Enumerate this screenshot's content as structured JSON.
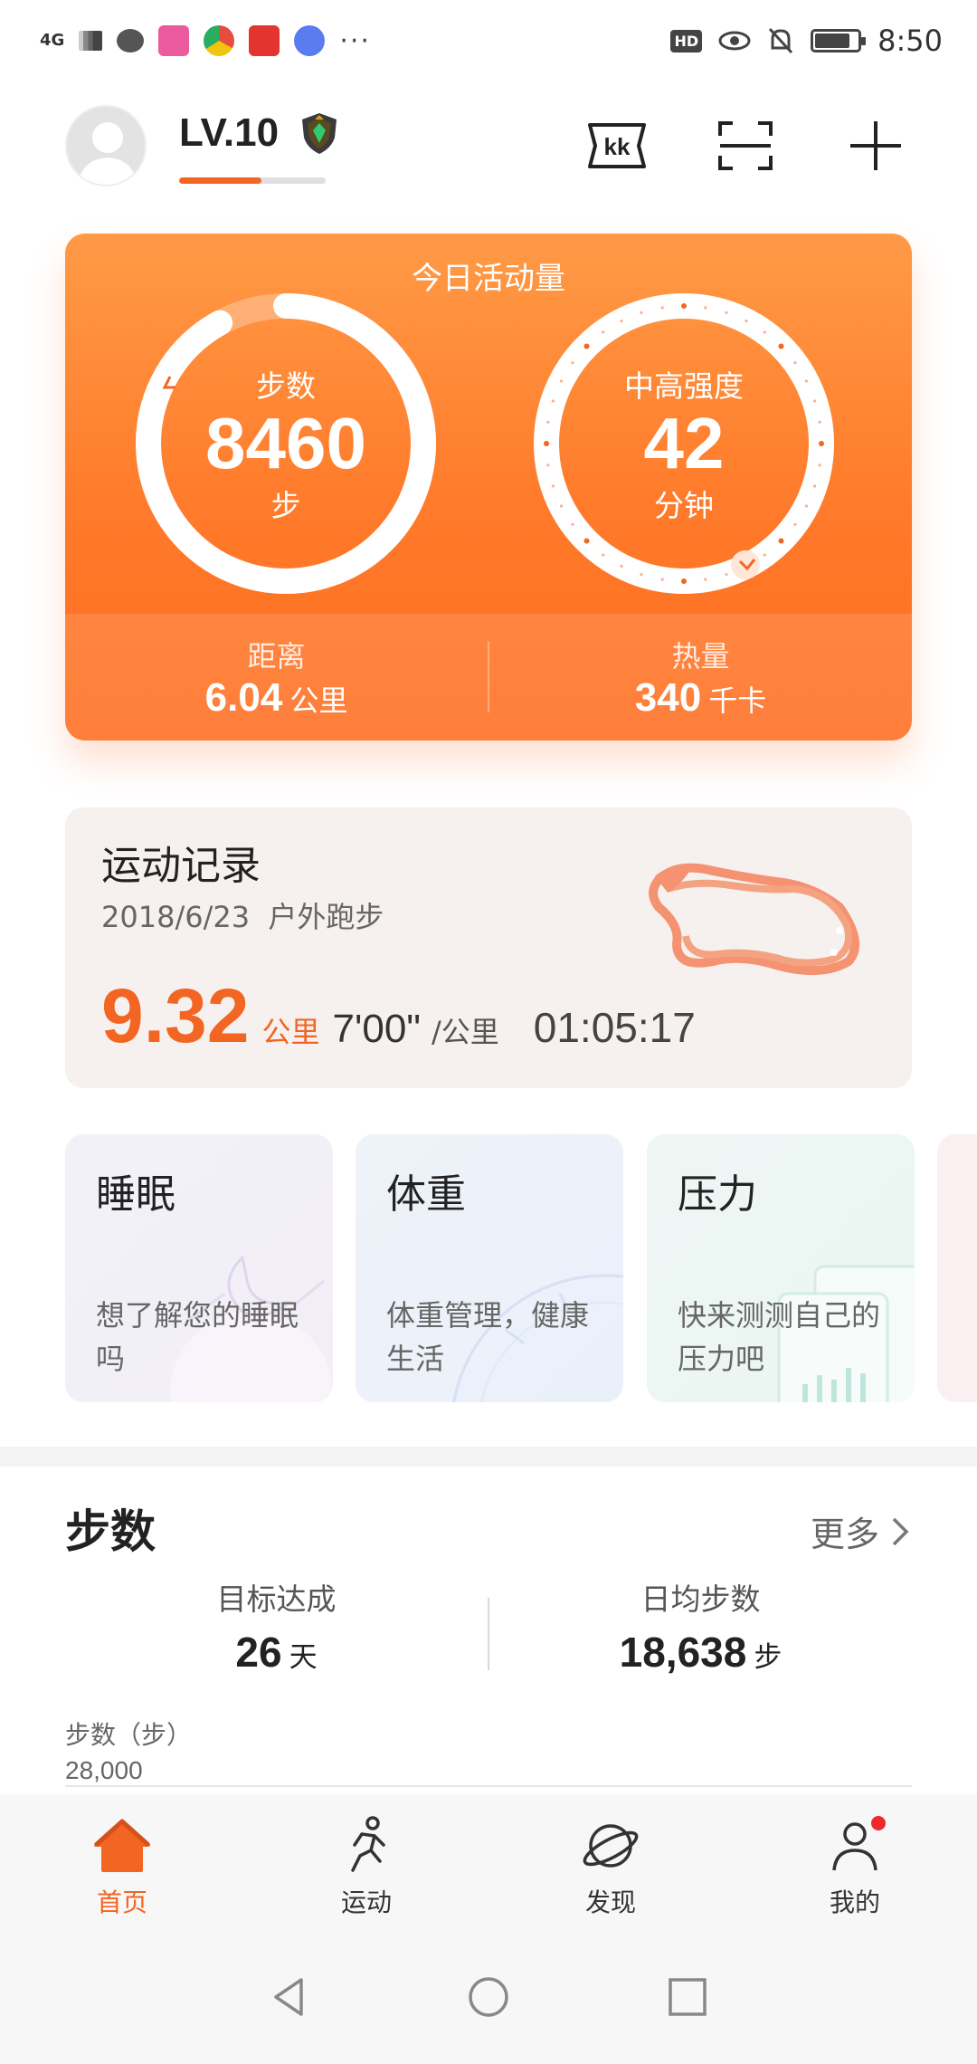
{
  "status_bar": {
    "network": "4G",
    "time": "8:50",
    "hd_label": "HD",
    "battery_level": 0.85
  },
  "header": {
    "level": "LV.10",
    "level_progress": 0.56
  },
  "activity": {
    "title": "今日活动量",
    "steps": {
      "label": "步数",
      "value": "8460",
      "unit": "步",
      "progress": 0.92
    },
    "intensity": {
      "label": "中高强度",
      "value": "42",
      "unit": "分钟"
    },
    "distance": {
      "label": "距离",
      "value": "6.04",
      "unit": "公里"
    },
    "calories": {
      "label": "热量",
      "value": "340",
      "unit": "千卡"
    }
  },
  "record": {
    "title": "运动记录",
    "date": "2018/6/23",
    "type": "户外跑步",
    "distance": "9.32",
    "distance_unit": "公里",
    "pace": "7'00\"",
    "pace_unit": "/公里",
    "duration": "01:05:17"
  },
  "health_cards": [
    {
      "title": "睡眠",
      "desc": "想了解您的睡眠吗"
    },
    {
      "title": "体重",
      "desc": "体重管理，健康生活"
    },
    {
      "title": "压力",
      "desc": "快来测测自己的压力吧"
    }
  ],
  "steps_section": {
    "title": "步数",
    "more": "更多",
    "goal_label": "目标达成",
    "goal_value": "26",
    "goal_unit": "天",
    "avg_label": "日均步数",
    "avg_value": "18,638",
    "avg_unit": "步",
    "chart_label": "步数（步）",
    "chart_max": "28,000"
  },
  "bottom_nav": [
    {
      "label": "首页",
      "icon": "home-icon",
      "active": true
    },
    {
      "label": "运动",
      "icon": "running-icon"
    },
    {
      "label": "发现",
      "icon": "planet-icon"
    },
    {
      "label": "我的",
      "icon": "person-icon"
    }
  ],
  "colors": {
    "accent": "#f26522",
    "card_orange": "#ff7a2a",
    "notification_red": "#f0282d"
  }
}
